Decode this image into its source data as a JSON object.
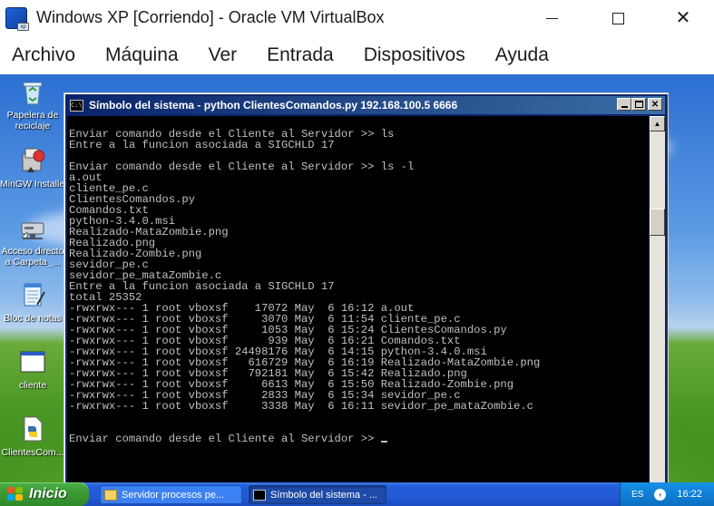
{
  "host_window": {
    "title": "Windows XP [Corriendo] - Oracle VM VirtualBox",
    "controls": {
      "minimize": "—",
      "maximize": "☐",
      "close": "✕"
    }
  },
  "host_menu": [
    "Archivo",
    "Máquina",
    "Ver",
    "Entrada",
    "Dispositivos",
    "Ayuda"
  ],
  "desktop_icons": [
    {
      "label": "Papelera de reciclaje",
      "icon": "recycle-bin-icon"
    },
    {
      "label": "MinGW Installe...",
      "icon": "installer-icon"
    },
    {
      "label": "Acceso directo a Carpeta_...",
      "icon": "network-drive-icon"
    },
    {
      "label": "Bloc de notas",
      "icon": "notepad-icon"
    },
    {
      "label": "cliente",
      "icon": "console-app-icon"
    },
    {
      "label": "ClientesCom...",
      "icon": "python-file-icon"
    }
  ],
  "cmd_window": {
    "title": "Símbolo del sistema - python ClientesComandos.py 192.168.100.5 6666",
    "icon_text": "C:\\",
    "lines": [
      "Enviar comando desde el Cliente al Servidor >> ls",
      "Entre a la funcion asociada a SIGCHLD 17",
      "",
      "Enviar comando desde el Cliente al Servidor >> ls -l",
      "a.out",
      "cliente_pe.c",
      "ClientesComandos.py",
      "Comandos.txt",
      "python-3.4.0.msi",
      "Realizado-MataZombie.png",
      "Realizado.png",
      "Realizado-Zombie.png",
      "sevidor_pe.c",
      "sevidor_pe_mataZombie.c",
      "Entre a la funcion asociada a SIGCHLD 17",
      "total 25352",
      "-rwxrwx--- 1 root vboxsf    17072 May  6 16:12 a.out",
      "-rwxrwx--- 1 root vboxsf     3070 May  6 11:54 cliente_pe.c",
      "-rwxrwx--- 1 root vboxsf     1053 May  6 15:24 ClientesComandos.py",
      "-rwxrwx--- 1 root vboxsf      939 May  6 16:21 Comandos.txt",
      "-rwxrwx--- 1 root vboxsf 24498176 May  6 14:15 python-3.4.0.msi",
      "-rwxrwx--- 1 root vboxsf   616729 May  6 16:19 Realizado-MataZombie.png",
      "-rwxrwx--- 1 root vboxsf   792181 May  6 15:42 Realizado.png",
      "-rwxrwx--- 1 root vboxsf     6613 May  6 15:50 Realizado-Zombie.png",
      "-rwxrwx--- 1 root vboxsf     2833 May  6 15:34 sevidor_pe.c",
      "-rwxrwx--- 1 root vboxsf     3338 May  6 16:11 sevidor_pe_mataZombie.c",
      "",
      ""
    ],
    "prompt_line": "Enviar comando desde el Cliente al Servidor >> "
  },
  "taskbar": {
    "start_label": "Inicio",
    "tasks": [
      {
        "label": "Servidor procesos pe...",
        "icon": "folder-icon"
      },
      {
        "label": "Símbolo del sistema - ...",
        "icon": "cmd-icon"
      }
    ],
    "tray": {
      "language": "ES",
      "clock": "16:22"
    }
  },
  "colors": {
    "console_bg": "#000000",
    "console_fg": "#c0c0c0",
    "xp_title_blue": "#0a246a",
    "taskbar_blue": "#245edb",
    "start_green": "#3c9a35"
  }
}
